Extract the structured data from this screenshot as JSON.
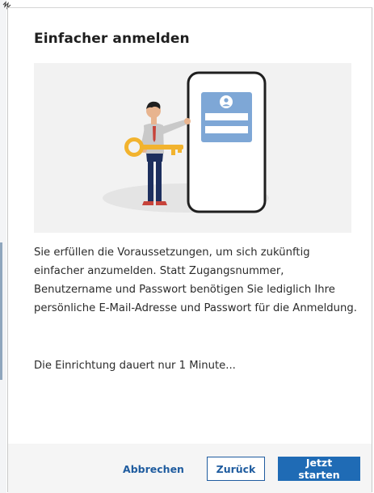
{
  "dialog": {
    "title": "Einfacher anmelden",
    "body": "Sie erfüllen die Voraussetzungen, um sich zukünftig einfacher anzumelden. Statt Zugangsnummer, Benutzername und Passwort benötigen Sie lediglich Ihre persönliche E-Mail-Adresse und Passwort für die Anmeldung.",
    "note": "Die Einrichtung dauert nur 1 Minute...",
    "illustration_icons": [
      "person-icon",
      "key-icon",
      "smartphone-icon",
      "user-avatar-icon"
    ]
  },
  "footer": {
    "cancel_label": "Abbrechen",
    "back_label": "Zurück",
    "start_label": "Jetzt starten"
  },
  "colors": {
    "accent": "#1f6bb5",
    "link": "#1f5c9f",
    "key": "#f2b32e",
    "phone_card": "#7ea7d6",
    "illustration_bg": "#f2f2f2",
    "footer_bg": "#f5f5f5"
  }
}
